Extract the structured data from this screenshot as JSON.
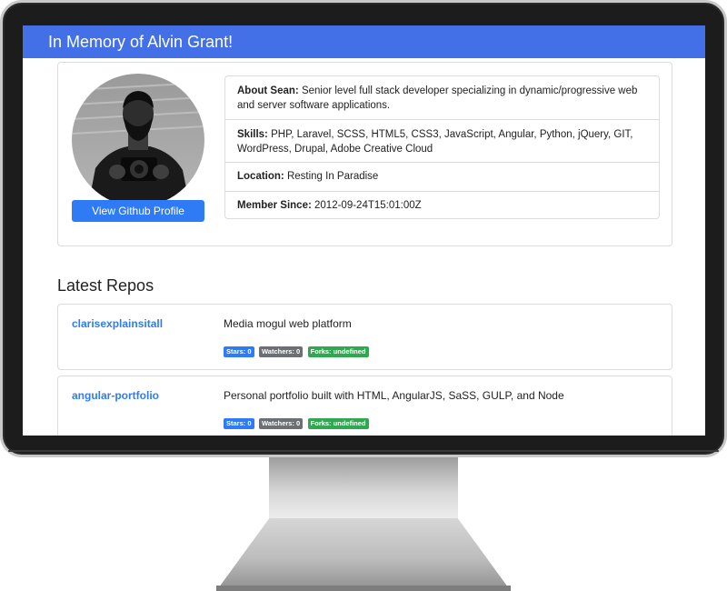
{
  "header": {
    "title": "In Memory of Alvin Grant!"
  },
  "profile": {
    "avatar_alt": "",
    "github_button_label": "View Github Profile",
    "about_label": "About Sean:",
    "about_value": "Senior level full stack developer specializing in dynamic/progressive web and server software applications.",
    "skills_label": "Skills:",
    "skills_value": "PHP, Laravel, SCSS, HTML5, CSS3, JavaScript, Angular, Python, jQuery, GIT, WordPress, Drupal, Adobe Creative Cloud",
    "location_label": "Location:",
    "location_value": "Resting In Paradise",
    "member_label": "Member Since:",
    "member_value": "2012-09-24T15:01:00Z"
  },
  "repos": {
    "heading": "Latest Repos",
    "items": [
      {
        "name": "clarisexplainsitall",
        "description": "Media mogul web platform",
        "stars": "Stars: 0",
        "watchers": "Watchers: 0",
        "forks": "Forks: undefined"
      },
      {
        "name": "angular-portfolio",
        "description": "Personal portfolio built with HTML, AngularJS, SaSS, GULP, and Node",
        "stars": "Stars: 0",
        "watchers": "Watchers: 0",
        "forks": "Forks: undefined"
      }
    ]
  },
  "colors": {
    "topbar": "#4370e7",
    "primary": "#2f7bf5",
    "secondary": "#6c6f73",
    "success": "#2fa84f"
  }
}
